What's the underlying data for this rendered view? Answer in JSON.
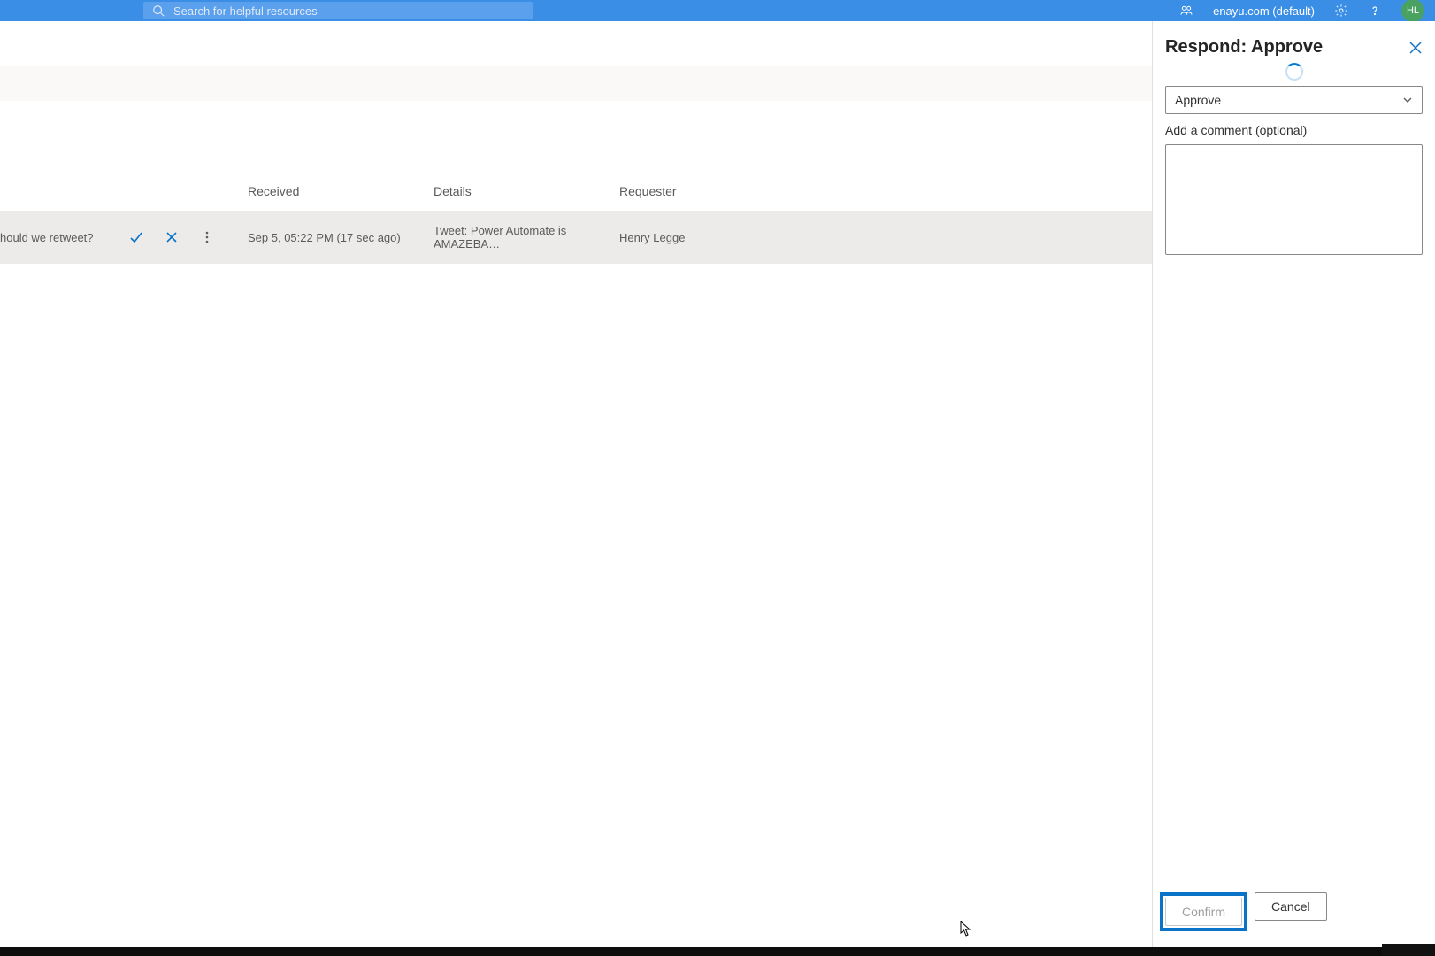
{
  "search": {
    "placeholder": "Search for helpful resources"
  },
  "environment": {
    "name": "enayu.com (default)"
  },
  "avatar": {
    "initials": "HL"
  },
  "table": {
    "headers": {
      "received": "Received",
      "details": "Details",
      "requester": "Requester"
    },
    "rows": [
      {
        "title": "hould we retweet?",
        "received": "Sep 5, 05:22 PM (17 sec ago)",
        "details": "Tweet: Power Automate is AMAZEBA…",
        "requester": "Henry Legge"
      }
    ]
  },
  "panel": {
    "title": "Respond: Approve",
    "select_value": "Approve",
    "comment_label": "Add a comment (optional)",
    "confirm": "Confirm",
    "cancel": "Cancel"
  }
}
